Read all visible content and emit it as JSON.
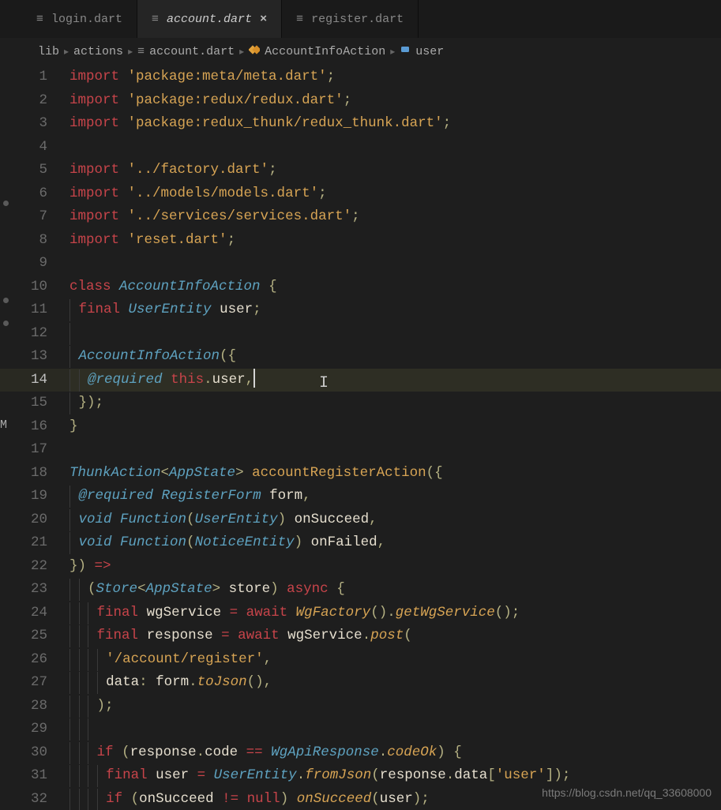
{
  "tabs": [
    {
      "label": "login.dart",
      "active": false
    },
    {
      "label": "account.dart",
      "active": true,
      "closable": true
    },
    {
      "label": "register.dart",
      "active": false
    }
  ],
  "breadcrumb": {
    "parts": [
      {
        "text": "lib"
      },
      {
        "text": "actions"
      },
      {
        "text": "account.dart",
        "icon": "file"
      },
      {
        "text": "AccountInfoAction",
        "icon": "class"
      },
      {
        "text": "user",
        "icon": "field"
      }
    ]
  },
  "side_marker": "M",
  "current_line": 14,
  "code": {
    "lines": [
      {
        "n": 1,
        "t": [
          [
            "kw-import",
            "import"
          ],
          [
            "",
            null
          ],
          [
            "str",
            "'package:meta/meta.dart'"
          ],
          [
            "p",
            ";"
          ]
        ]
      },
      {
        "n": 2,
        "t": [
          [
            "kw-import",
            "import"
          ],
          [
            "",
            null
          ],
          [
            "str",
            "'package:redux/redux.dart'"
          ],
          [
            "p",
            ";"
          ]
        ]
      },
      {
        "n": 3,
        "t": [
          [
            "kw-import",
            "import"
          ],
          [
            "",
            null
          ],
          [
            "str",
            "'package:redux_thunk/redux_thunk.dart'"
          ],
          [
            "p",
            ";"
          ]
        ]
      },
      {
        "n": 4,
        "t": []
      },
      {
        "n": 5,
        "t": [
          [
            "kw-import",
            "import"
          ],
          [
            "",
            null
          ],
          [
            "str",
            "'../factory.dart'"
          ],
          [
            "p",
            ";"
          ]
        ]
      },
      {
        "n": 6,
        "t": [
          [
            "kw-import",
            "import"
          ],
          [
            "",
            null
          ],
          [
            "str",
            "'../models/models.dart'"
          ],
          [
            "p",
            ";"
          ]
        ]
      },
      {
        "n": 7,
        "t": [
          [
            "kw-import",
            "import"
          ],
          [
            "",
            null
          ],
          [
            "str",
            "'../services/services.dart'"
          ],
          [
            "p",
            ";"
          ]
        ]
      },
      {
        "n": 8,
        "t": [
          [
            "kw-import",
            "import"
          ],
          [
            "",
            null
          ],
          [
            "str",
            "'reset.dart'"
          ],
          [
            "p",
            ";"
          ]
        ]
      },
      {
        "n": 9,
        "t": []
      },
      {
        "n": 10,
        "t": [
          [
            "kw-class",
            "class"
          ],
          [
            "",
            null
          ],
          [
            "typ",
            "AccountInfoAction"
          ],
          [
            "",
            null
          ],
          [
            "p",
            "{"
          ]
        ]
      },
      {
        "n": 11,
        "i": 1,
        "t": [
          [
            "kw-final",
            "final"
          ],
          [
            "",
            null
          ],
          [
            "typ",
            "UserEntity"
          ],
          [
            "",
            null
          ],
          [
            "id",
            "user"
          ],
          [
            "p",
            ";"
          ]
        ]
      },
      {
        "n": 12,
        "i": 1,
        "t": []
      },
      {
        "n": 13,
        "i": 1,
        "t": [
          [
            "typ",
            "AccountInfoAction"
          ],
          [
            "p",
            "({"
          ]
        ]
      },
      {
        "n": 14,
        "i": 2,
        "cur": true,
        "t": [
          [
            "ann",
            "@required"
          ],
          [
            "",
            null
          ],
          [
            "kw-this",
            "this"
          ],
          [
            "p",
            "."
          ],
          [
            "id",
            "user"
          ],
          [
            "p",
            ","
          ]
        ],
        "cursor": true
      },
      {
        "n": 15,
        "i": 1,
        "t": [
          [
            "p",
            "});"
          ]
        ]
      },
      {
        "n": 16,
        "t": [
          [
            "p",
            "}"
          ]
        ]
      },
      {
        "n": 17,
        "t": []
      },
      {
        "n": 18,
        "t": [
          [
            "typ",
            "ThunkAction"
          ],
          [
            "p",
            "<"
          ],
          [
            "typ",
            "AppState"
          ],
          [
            "p",
            ">"
          ],
          [
            "",
            null
          ],
          [
            "fn",
            "accountRegisterAction"
          ],
          [
            "p",
            "({"
          ]
        ]
      },
      {
        "n": 19,
        "i": 1,
        "t": [
          [
            "ann",
            "@required"
          ],
          [
            "",
            null
          ],
          [
            "typ",
            "RegisterForm"
          ],
          [
            "",
            null
          ],
          [
            "id",
            "form"
          ],
          [
            "p",
            ","
          ]
        ]
      },
      {
        "n": 20,
        "i": 1,
        "t": [
          [
            "kw-void",
            "void"
          ],
          [
            "",
            null
          ],
          [
            "typ",
            "Function"
          ],
          [
            "p",
            "("
          ],
          [
            "typ",
            "UserEntity"
          ],
          [
            "p",
            ")"
          ],
          [
            "",
            null
          ],
          [
            "id",
            "onSucceed"
          ],
          [
            "p",
            ","
          ]
        ]
      },
      {
        "n": 21,
        "i": 1,
        "t": [
          [
            "kw-void",
            "void"
          ],
          [
            "",
            null
          ],
          [
            "typ",
            "Function"
          ],
          [
            "p",
            "("
          ],
          [
            "typ",
            "NoticeEntity"
          ],
          [
            "p",
            ")"
          ],
          [
            "",
            null
          ],
          [
            "id",
            "onFailed"
          ],
          [
            "p",
            ","
          ]
        ]
      },
      {
        "n": 22,
        "t": [
          [
            "p",
            "})"
          ],
          [
            "",
            null
          ],
          [
            "op",
            "=>"
          ]
        ]
      },
      {
        "n": 23,
        "i": 2,
        "t": [
          [
            "p",
            "("
          ],
          [
            "typ",
            "Store"
          ],
          [
            "p",
            "<"
          ],
          [
            "typ",
            "AppState"
          ],
          [
            "p",
            ">"
          ],
          [
            "",
            null
          ],
          [
            "id",
            "store"
          ],
          [
            "p",
            ")"
          ],
          [
            "",
            null
          ],
          [
            "kw-async",
            "async"
          ],
          [
            "",
            null
          ],
          [
            "p",
            "{"
          ]
        ]
      },
      {
        "n": 24,
        "i": 3,
        "t": [
          [
            "kw-final",
            "final"
          ],
          [
            "",
            null
          ],
          [
            "id",
            "wgService"
          ],
          [
            "",
            null
          ],
          [
            "op",
            "="
          ],
          [
            "",
            null
          ],
          [
            "kw-await",
            "await"
          ],
          [
            "",
            null
          ],
          [
            "fn-i",
            "WgFactory"
          ],
          [
            "p",
            "()."
          ],
          [
            "fn-i",
            "getWgService"
          ],
          [
            "p",
            "();"
          ]
        ]
      },
      {
        "n": 25,
        "i": 3,
        "t": [
          [
            "kw-final",
            "final"
          ],
          [
            "",
            null
          ],
          [
            "id",
            "response"
          ],
          [
            "",
            null
          ],
          [
            "op",
            "="
          ],
          [
            "",
            null
          ],
          [
            "kw-await",
            "await"
          ],
          [
            "",
            null
          ],
          [
            "id",
            "wgService"
          ],
          [
            "p",
            "."
          ],
          [
            "fn-i",
            "post"
          ],
          [
            "p",
            "("
          ]
        ]
      },
      {
        "n": 26,
        "i": 4,
        "t": [
          [
            "str",
            "'/account/register'"
          ],
          [
            "p",
            ","
          ]
        ]
      },
      {
        "n": 27,
        "i": 4,
        "t": [
          [
            "id",
            "data"
          ],
          [
            "p",
            ":"
          ],
          [
            "",
            null
          ],
          [
            "id",
            "form"
          ],
          [
            "p",
            "."
          ],
          [
            "fn-i",
            "toJson"
          ],
          [
            "p",
            "(),"
          ]
        ]
      },
      {
        "n": 28,
        "i": 3,
        "t": [
          [
            "p",
            ");"
          ]
        ]
      },
      {
        "n": 29,
        "i": 3,
        "t": []
      },
      {
        "n": 30,
        "i": 3,
        "t": [
          [
            "kw-if",
            "if"
          ],
          [
            "",
            null
          ],
          [
            "p",
            "("
          ],
          [
            "id",
            "response"
          ],
          [
            "p",
            "."
          ],
          [
            "id",
            "code"
          ],
          [
            "",
            null
          ],
          [
            "op",
            "=="
          ],
          [
            "",
            null
          ],
          [
            "typ",
            "WgApiResponse"
          ],
          [
            "p",
            "."
          ],
          [
            "prop-i",
            "codeOk"
          ],
          [
            "p",
            ")"
          ],
          [
            "",
            null
          ],
          [
            "p",
            "{"
          ]
        ]
      },
      {
        "n": 31,
        "i": 4,
        "t": [
          [
            "kw-final",
            "final"
          ],
          [
            "",
            null
          ],
          [
            "id",
            "user"
          ],
          [
            "",
            null
          ],
          [
            "op",
            "="
          ],
          [
            "",
            null
          ],
          [
            "typ",
            "UserEntity"
          ],
          [
            "p",
            "."
          ],
          [
            "fn-i",
            "fromJson"
          ],
          [
            "p",
            "("
          ],
          [
            "id",
            "response"
          ],
          [
            "p",
            "."
          ],
          [
            "id",
            "data"
          ],
          [
            "p",
            "["
          ],
          [
            "str",
            "'user'"
          ],
          [
            "p",
            "]);"
          ]
        ]
      },
      {
        "n": 32,
        "i": 4,
        "t": [
          [
            "kw-if",
            "if"
          ],
          [
            "",
            null
          ],
          [
            "p",
            "("
          ],
          [
            "id",
            "onSucceed"
          ],
          [
            "",
            null
          ],
          [
            "op",
            "!="
          ],
          [
            "",
            null
          ],
          [
            "kw-null",
            "null"
          ],
          [
            "p",
            ")"
          ],
          [
            "",
            null
          ],
          [
            "fn-i",
            "onSucceed"
          ],
          [
            "p",
            "("
          ],
          [
            "id",
            "user"
          ],
          [
            "p",
            ");"
          ]
        ]
      }
    ]
  },
  "watermark": "https://blog.csdn.net/qq_33608000"
}
